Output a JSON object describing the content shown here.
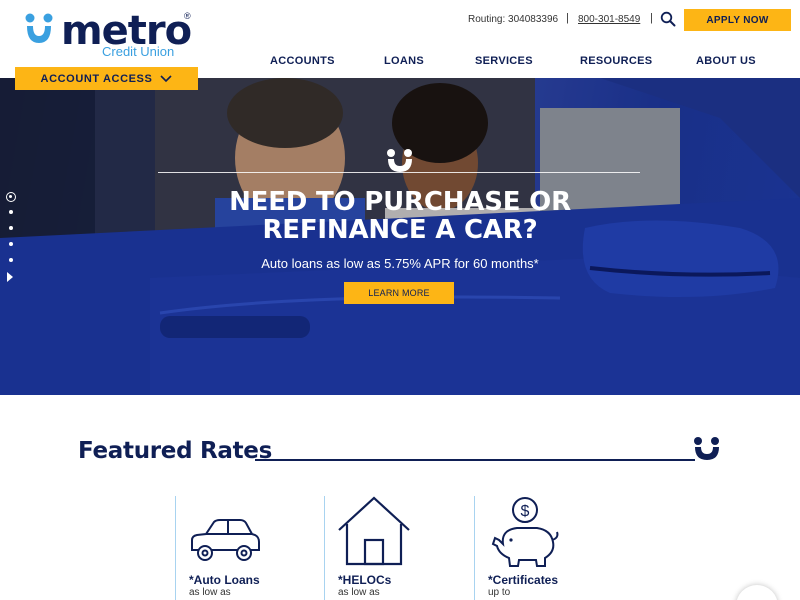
{
  "brand": {
    "name": "metro",
    "registered": "®",
    "subtitle": "Credit Union",
    "colors": {
      "navy": "#0f1f55",
      "gold": "#fdb515",
      "light_blue": "#3aa0e0"
    }
  },
  "utility": {
    "routing": "Routing: 304083396",
    "separator": "|",
    "phone": "800-301-8549",
    "search_icon": "search-icon",
    "apply_label": "APPLY NOW"
  },
  "nav": {
    "items": [
      {
        "label": "ACCOUNTS"
      },
      {
        "label": "LOANS"
      },
      {
        "label": "SERVICES"
      },
      {
        "label": "RESOURCES"
      },
      {
        "label": "ABOUT US"
      }
    ]
  },
  "account_access": {
    "label": "ACCOUNT ACCESS",
    "icon": "chevron-down-icon"
  },
  "hero": {
    "title_line1": "NEED TO PURCHASE OR",
    "title_line2": "REFINANCE A CAR?",
    "subtitle": "Auto loans as low as 5.75% APR for 60 months*",
    "cta_label": "LEARN MORE",
    "slides": {
      "count": 5,
      "active_index": 0
    }
  },
  "featured": {
    "title": "Featured Rates",
    "cards": [
      {
        "name": "*Auto Loans",
        "note": "as low as",
        "icon": "car-icon"
      },
      {
        "name": "*HELOCs",
        "note": "as low as",
        "icon": "house-icon"
      },
      {
        "name": "*Certificates",
        "note": "up to",
        "icon": "piggy-bank-icon"
      }
    ]
  }
}
